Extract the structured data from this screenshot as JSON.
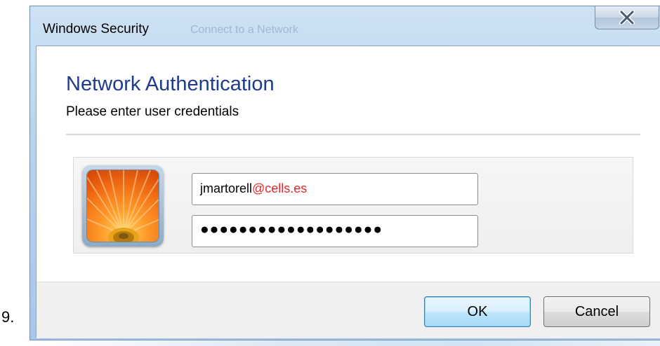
{
  "step_label": "9.",
  "window": {
    "title": "Windows Security",
    "ghost_title": "Connect to a Network"
  },
  "dialog": {
    "heading": "Network Authentication",
    "subheading": "Please enter user credentials"
  },
  "credentials": {
    "username_user": "jmartorell",
    "username_domain": "@cells.es",
    "password_mask": "●●●●●●●●●●●●●●●●●●●"
  },
  "buttons": {
    "ok": "OK",
    "cancel": "Cancel"
  },
  "icons": {
    "close": "close-icon",
    "avatar": "user-tile-flower"
  },
  "colors": {
    "heading": "#1f3b8c",
    "domain_text": "#e3282d"
  }
}
